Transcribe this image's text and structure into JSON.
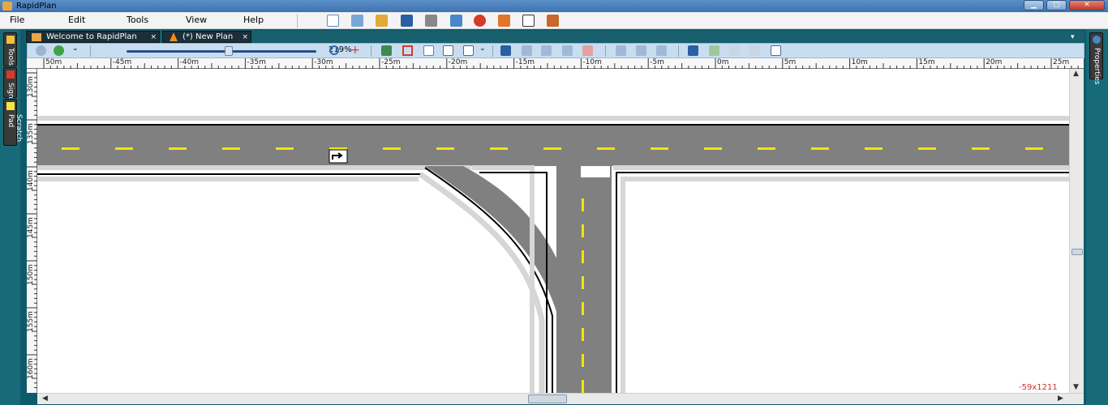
{
  "window": {
    "title": "RapidPlan"
  },
  "menu": {
    "items": [
      "File",
      "Edit",
      "Tools",
      "View",
      "Help"
    ]
  },
  "toolbar": {
    "icons": [
      "new-file-icon",
      "open-icon",
      "import-icon",
      "save-icon",
      "print-icon",
      "export-icon",
      "stop-icon",
      "signs-icon",
      "check-icon",
      "exit-icon"
    ]
  },
  "dock_left": {
    "items": [
      "Tools",
      "Signs",
      "Scratch Pad"
    ]
  },
  "dock_right": {
    "items": [
      "Properties"
    ]
  },
  "tabs": [
    {
      "label": "Welcome to RapidPlan",
      "close": "×"
    },
    {
      "label": "(*) New Plan",
      "close": "×"
    }
  ],
  "plan_toolbar": {
    "zoom_text": "219%",
    "zoom_fraction": 0.54
  },
  "ruler": {
    "h": [
      "50m",
      "-45m",
      "-40m",
      "-35m",
      "-30m",
      "-25m",
      "-20m",
      "-15m",
      "-10m",
      "-5m",
      "0m",
      "5m",
      "10m",
      "15m",
      "20m",
      "25m"
    ],
    "v": [
      "130m",
      "135m",
      "140m",
      "145m",
      "150m",
      "155m",
      "160m"
    ]
  },
  "status": {
    "coords": "-59x1211"
  },
  "colors": {
    "road": "#808080",
    "curb": "#d6d6d6",
    "centerline": "#f2e600",
    "accent": "#244f87"
  }
}
